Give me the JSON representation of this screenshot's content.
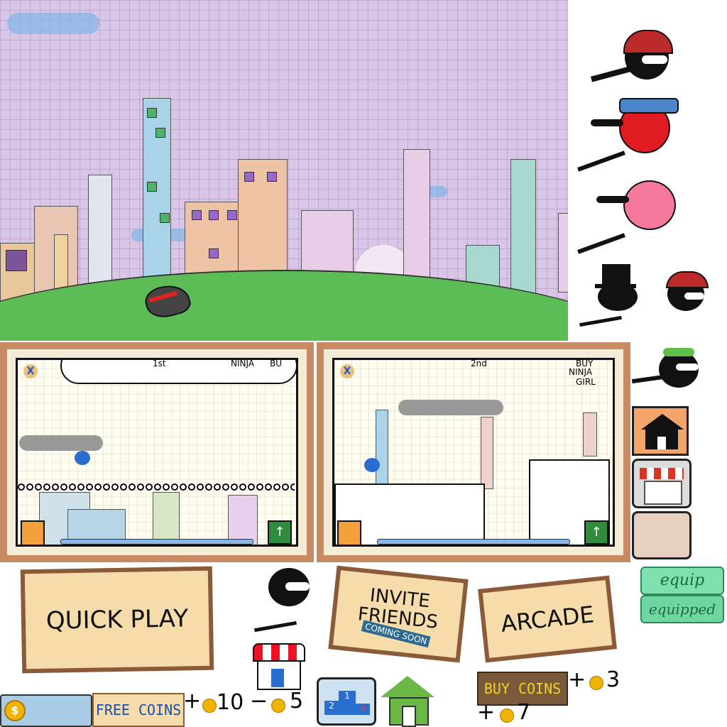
{
  "menu": {
    "quick_play": "QUICK PLAY",
    "invite_line1": "INVITE",
    "invite_line2": "FRIENDS",
    "coming_soon": "COMING SOON",
    "arcade": "ARCADE",
    "equip": "equip",
    "equipped": "equipped",
    "buy_coins": "BUY COINS",
    "free_coins": "FREE COINS"
  },
  "rewards": {
    "plus_10": "+",
    "ten": "10",
    "minus": "−",
    "five": "5",
    "plus_3": "+",
    "three": "3",
    "plus_7": "+",
    "seven": "7"
  },
  "preview_left": {
    "rank": "1st",
    "top_right": "NINJA",
    "top_right2": "BU"
  },
  "preview_right": {
    "rank": "2nd",
    "line1": "BUY",
    "line2": "NINJA",
    "line3": "GIRL"
  },
  "podium": {
    "first": "1",
    "second": "2",
    "third": "3"
  },
  "colors": {
    "wood": "#c98b64",
    "sign": "#f6dcaa",
    "equip_green": "#6fd6a0",
    "sky": "#d9c6e6",
    "hill": "#5cbd57"
  },
  "icons": [
    "ninja-viking-icon",
    "ninja-girl-red-icon",
    "ninja-girl-pink-icon",
    "ninja-tophat-icon",
    "ninja-viking-small-icon",
    "ninja-leaf-icon",
    "house-icon",
    "shop-icon",
    "blank-slot-icon",
    "coin-icon",
    "podium-icon",
    "home-icon",
    "ninja-runner-icon"
  ]
}
